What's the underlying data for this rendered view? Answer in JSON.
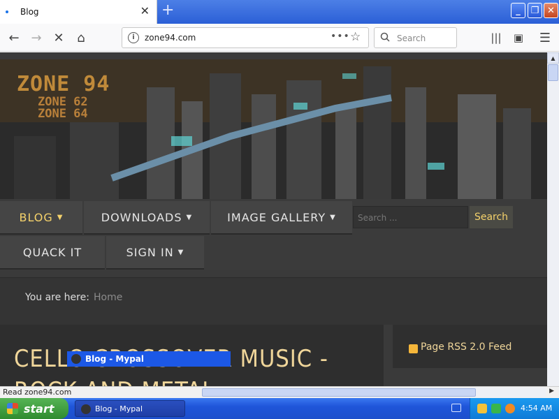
{
  "browser": {
    "tab_title": "Blog",
    "url": "zone94.com",
    "search_placeholder": "Search",
    "status_text": "Read zone94.com"
  },
  "hero": {
    "logo_line1": "ZONE 94",
    "logo_line2": "ZONE 62",
    "logo_line3": "ZONE 64"
  },
  "menu": {
    "items": [
      {
        "label": "BLOG",
        "caret": "▼"
      },
      {
        "label": "DOWNLOADS",
        "caret": "▼"
      },
      {
        "label": "IMAGE GALLERY",
        "caret": "▼"
      },
      {
        "label": "QUACK IT",
        "caret": ""
      },
      {
        "label": "SIGN IN",
        "caret": "▼"
      }
    ],
    "search_placeholder": "Search ...",
    "search_button": "Search"
  },
  "breadcrumb": {
    "label": "You are here:",
    "current": "Home"
  },
  "article": {
    "title": "CELLO CROSSOVER MUSIC - ROCK AND METAL"
  },
  "sidebar": {
    "rss_label": "Page RSS 2.0 Feed"
  },
  "tooltip": {
    "text": "Blog - Mypal"
  },
  "taskbar": {
    "start_label": "start",
    "task_label": "Blog - Mypal",
    "clock": "4:54 AM"
  },
  "colors": {
    "accent_gold": "#f0d69a",
    "menu_active": "#f5d26b",
    "xp_blue": "#1f55d9"
  }
}
